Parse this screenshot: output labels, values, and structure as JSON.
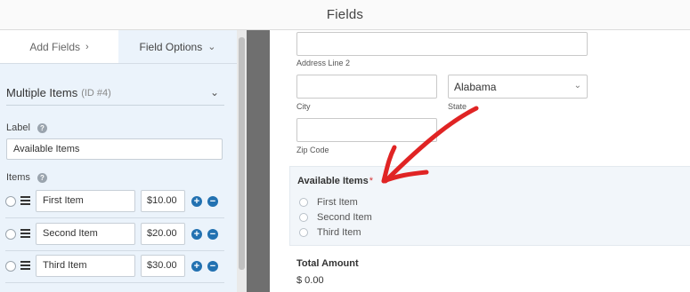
{
  "header": {
    "title": "Fields"
  },
  "tabs": {
    "add": "Add Fields",
    "options": "Field Options"
  },
  "field": {
    "name": "Multiple Items",
    "id_text": "(ID #4)"
  },
  "label_section": {
    "title": "Label",
    "value": "Available Items"
  },
  "items_section": {
    "title": "Items",
    "rows": [
      {
        "label": "First Item",
        "price": "$10.00"
      },
      {
        "label": "Second Item",
        "price": "$20.00"
      },
      {
        "label": "Third Item",
        "price": "$30.00"
      }
    ]
  },
  "icons": {
    "help": "question-circle-icon",
    "drag": "drag-handle-icon",
    "add": "plus-circle-icon",
    "remove": "minus-circle-icon",
    "arrow": "red-hand-drawn-arrow-icon"
  },
  "colors": {
    "accent": "#2271b1",
    "required": "#d63638",
    "arrow": "#e02424",
    "panel_bg": "#ebf3fb"
  },
  "preview": {
    "address_line_2": "Address Line 2",
    "city": "City",
    "state": "State",
    "state_value": "Alabama",
    "zip": "Zip Code",
    "items_field": {
      "label": "Available Items",
      "required_mark": "*",
      "options": [
        "First Item",
        "Second Item",
        "Third Item"
      ]
    },
    "total_label": "Total Amount",
    "total_value": "$ 0.00"
  }
}
